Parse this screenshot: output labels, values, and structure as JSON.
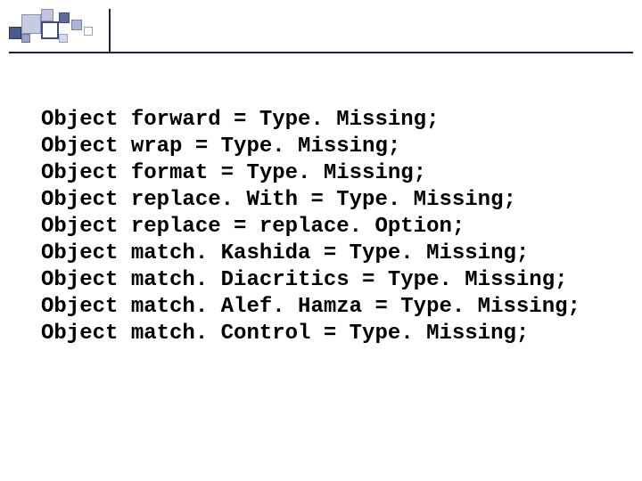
{
  "code": {
    "lines": [
      "Object forward = Type. Missing;",
      "Object wrap = Type. Missing;",
      "Object format = Type. Missing;",
      "Object replace. With = Type. Missing;",
      "Object replace = replace. Option;",
      "Object match. Kashida = Type. Missing;",
      "Object match. Diacritics = Type. Missing;",
      "Object match. Alef. Hamza = Type. Missing;",
      "Object match. Control = Type. Missing;"
    ]
  }
}
